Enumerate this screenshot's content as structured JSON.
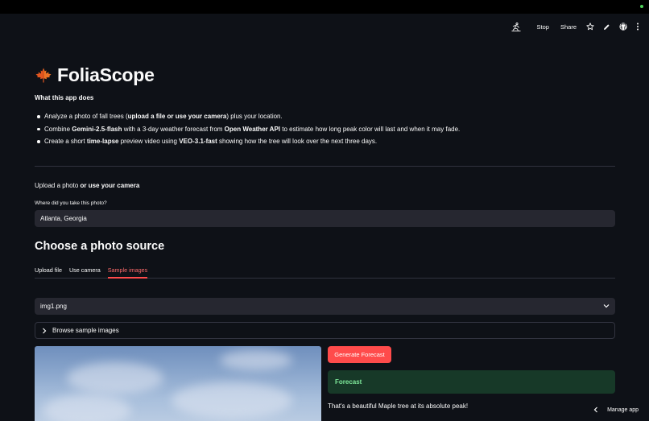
{
  "toolbar": {
    "stop_label": "Stop",
    "share_label": "Share",
    "icons": [
      "running-man-icon",
      "star-icon",
      "pencil-icon",
      "github-icon",
      "kebab-menu-icon"
    ]
  },
  "header": {
    "title": "FoliaScope",
    "icon": "maple-leaf-icon"
  },
  "about": {
    "heading": "What this app does",
    "bullets": [
      {
        "pre": "Analyze a photo of fall trees (",
        "bold": "upload a file or use your camera",
        "post": ") plus your location."
      },
      {
        "pre": "Combine ",
        "bold": "Gemini-2.5-flash",
        "mid": " with a 3-day weather forecast from ",
        "bold2": "Open Weather API",
        "post": " to estimate how long peak color will last and when it may fade."
      },
      {
        "pre": "Create a short ",
        "bold": "time-lapse",
        "mid": " preview video using ",
        "bold2": "VEO-3.1-fast",
        "post": " showing how the tree will look over the next three days."
      }
    ]
  },
  "upload": {
    "label_pre": "Upload a photo ",
    "label_bold": "or use your camera"
  },
  "location": {
    "label": "Where did you take this photo?",
    "value": "Atlanta, Georgia"
  },
  "source": {
    "title": "Choose a photo source",
    "tabs": [
      "Upload file",
      "Use camera",
      "Sample images"
    ],
    "active_tab": "Sample images",
    "select_value": "img1.png",
    "expander_label": "Browse sample images"
  },
  "actions": {
    "generate_label": "Generate Forecast"
  },
  "forecast": {
    "heading": "Forecast",
    "text": "That's a beautiful Maple tree at its absolute peak!"
  },
  "footer": {
    "manage_label": "Manage app"
  },
  "colors": {
    "background": "#0e1117",
    "accent": "#ff4b4b",
    "success_bg": "#173928",
    "success_text": "#7ee89a",
    "input_bg": "#262730"
  }
}
